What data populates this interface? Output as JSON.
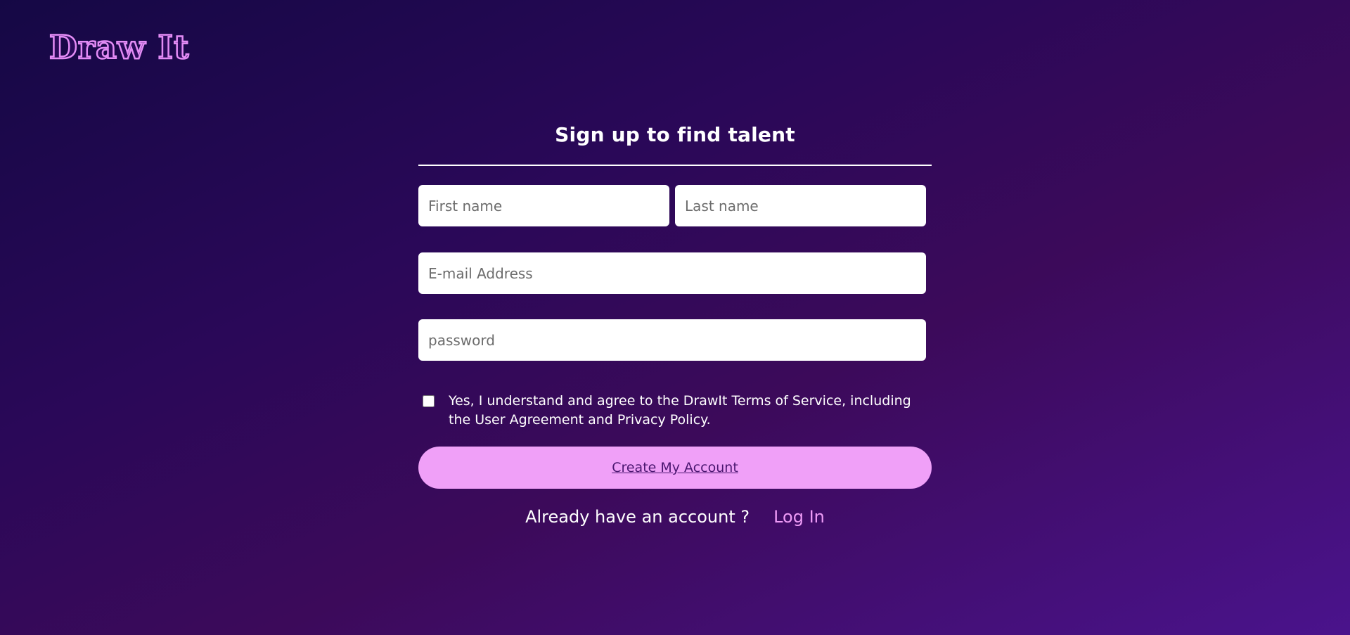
{
  "brand": {
    "logo_text": "Draw It"
  },
  "form": {
    "title": "Sign up to find talent",
    "first_name_placeholder": "First name",
    "last_name_placeholder": "Last name",
    "email_placeholder": "E-mail Address",
    "password_placeholder": "password",
    "agree_checked": false,
    "agree_text": "Yes, I understand and agree to the DrawIt Terms of Service, including the User Agreement and Privacy Policy.",
    "submit_label": "Create My Account"
  },
  "footer": {
    "already_text": "Already have an account ?",
    "login_label": "Log In"
  },
  "colors": {
    "button_bg": "#f0a0f8",
    "link": "#ef9cf7",
    "logo_outline": "#e38cf5"
  }
}
